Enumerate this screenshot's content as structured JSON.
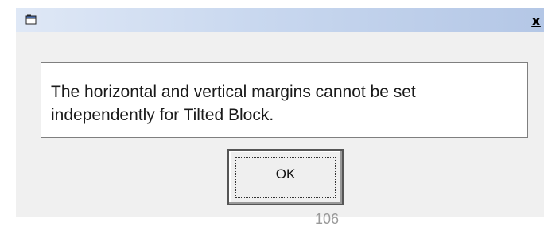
{
  "dialog": {
    "title": "",
    "close_label": "x",
    "message": "The horizontal and vertical margins cannot be set independently for Tilted Block.",
    "ok_label": "OK"
  },
  "page": {
    "number": "106"
  }
}
